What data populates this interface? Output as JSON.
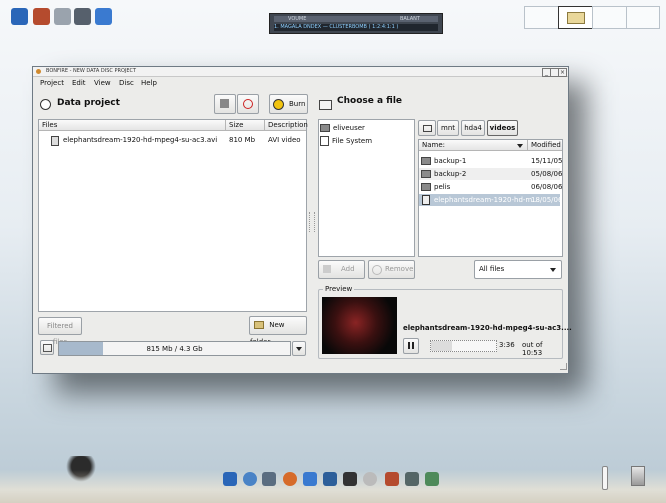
{
  "player": {
    "top_left": "VOUME",
    "top_right": "BALANT",
    "marquee": "1. MAGALA DNDEX — CLUSTERBOMB  ( 1:2:4:1:1 )"
  },
  "window": {
    "title": "BONFIRE - NEW DATA DISC PROJECT"
  },
  "menu": [
    "Project",
    "Edit",
    "View",
    "Disc",
    "Help"
  ],
  "left": {
    "title": "Data project",
    "burn_label": "Burn",
    "columns": [
      "Files",
      "Size",
      "Description"
    ],
    "rows": [
      {
        "name": "elephantsdream-1920-hd-mpeg4-su-ac3.avi",
        "size": "810 Mb",
        "desc": "AVI video"
      }
    ],
    "filtered_label": "Filtered files",
    "new_folder_label": "New folder",
    "usage": "815 Mb / 4.3 Gb",
    "usage_fraction": 0.19
  },
  "right": {
    "title": "Choose a file",
    "places": [
      "eliveuser",
      "File System"
    ],
    "path": [
      "mnt",
      "hda4",
      "videos"
    ],
    "columns": [
      "Name:",
      "Modified"
    ],
    "files": [
      {
        "name": "backup-1",
        "modified": "15/11/05"
      },
      {
        "name": "backup-2",
        "modified": "05/08/06"
      },
      {
        "name": "pelis",
        "modified": "06/08/06"
      },
      {
        "name": "elephantsdream-1920-hd-m…",
        "modified": "18/05/06"
      }
    ],
    "add_label": "Add",
    "remove_label": "Remove",
    "filter": "All files",
    "preview_label": "Preview",
    "preview_file": "elephantsdream-1920-hd-mpeg4-su-ac3....",
    "time": "3:36",
    "total": "out of 10:53",
    "seek_fraction": 0.33
  },
  "colors": {
    "selection": "#b8c7d6",
    "progress": "#a7b9cc",
    "accent": "#2a6db0"
  }
}
